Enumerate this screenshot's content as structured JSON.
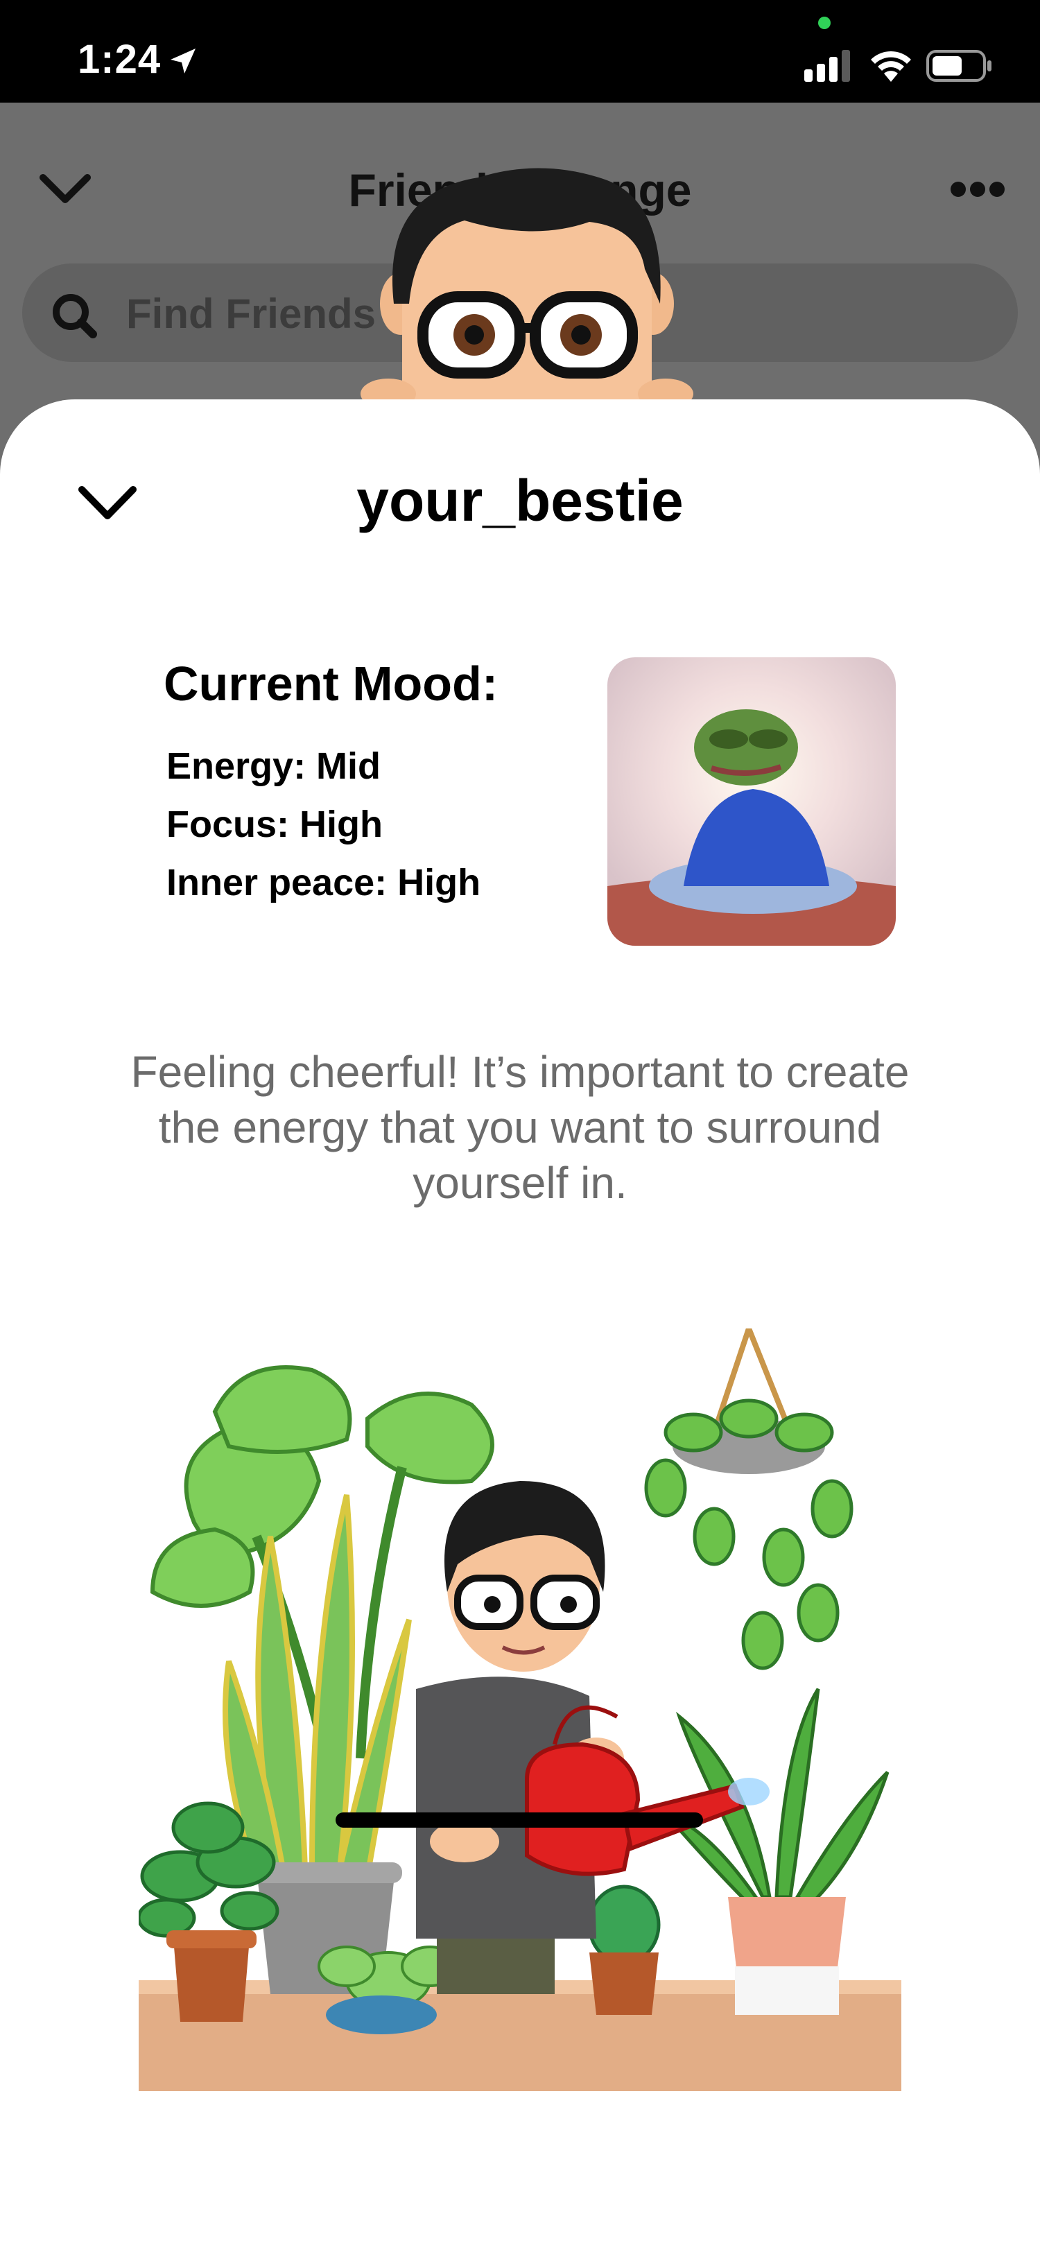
{
  "status_bar": {
    "time": "1:24"
  },
  "background_screen": {
    "title": "Friends Lounge",
    "search_placeholder": "Find Friends"
  },
  "sheet": {
    "username": "your_bestie",
    "mood_heading": "Current Mood:",
    "mood_lines": [
      "Energy: Mid",
      "Focus: High",
      "Inner peace: High"
    ],
    "quote": "Feeling cheerful! It’s important to create the energy that you want to surround yourself in."
  },
  "icons": {
    "status_arrow": "location-arrow-icon",
    "signal": "cellular-signal-icon",
    "wifi": "wifi-icon",
    "battery": "battery-icon",
    "back": "chevron-down-icon",
    "more": "more-icon",
    "search": "search-icon",
    "close": "chevron-down-icon"
  },
  "colors": {
    "status_dot": "#30d158",
    "quote_text": "#6b6b6b",
    "sheet_background": "#ffffff",
    "dim_background": "#6e6e6e"
  }
}
